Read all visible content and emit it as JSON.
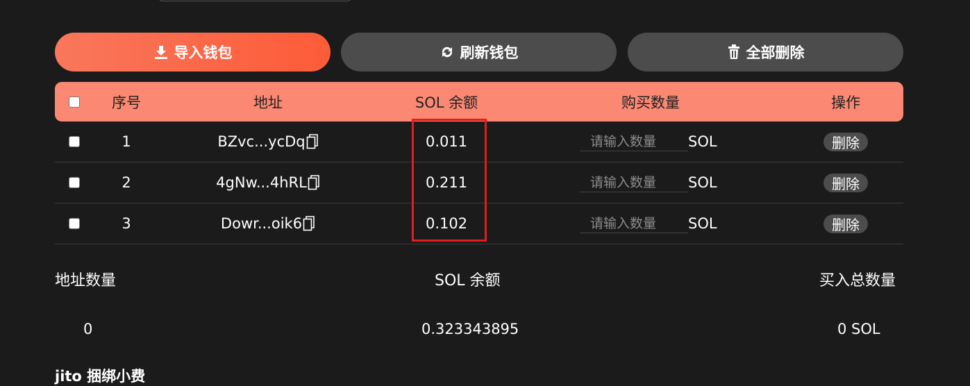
{
  "toolbar": {
    "import_label": "导入钱包",
    "refresh_label": "刷新钱包",
    "delete_all_label": "全部删除"
  },
  "table": {
    "headers": {
      "index": "序号",
      "address": "地址",
      "balance": "SOL 余额",
      "buy_amount": "购买数量",
      "action": "操作"
    },
    "rows": [
      {
        "index": "1",
        "address": "BZvc...ycDq",
        "balance": "0.011",
        "qty_placeholder": "请输入数量",
        "unit": "SOL",
        "delete_label": "删除"
      },
      {
        "index": "2",
        "address": "4gNw...4hRL",
        "balance": "0.211",
        "qty_placeholder": "请输入数量",
        "unit": "SOL",
        "delete_label": "删除"
      },
      {
        "index": "3",
        "address": "Dowr...oik6",
        "balance": "0.102",
        "qty_placeholder": "请输入数量",
        "unit": "SOL",
        "delete_label": "删除"
      }
    ]
  },
  "summary": {
    "address_count_label": "地址数量",
    "address_count_value": "0",
    "sol_balance_label": "SOL 余额",
    "sol_balance_value": "0.323343895",
    "total_buy_label": "买入总数量",
    "total_buy_value": "0 SOL"
  },
  "footer_cut_text": "jito 捆绑小费",
  "colors": {
    "background": "#1b1b1b",
    "accent": "#fd5b38",
    "header_bg": "#fb8873",
    "button_gray": "#4c4c4c",
    "highlight_border": "#e11d1d"
  }
}
